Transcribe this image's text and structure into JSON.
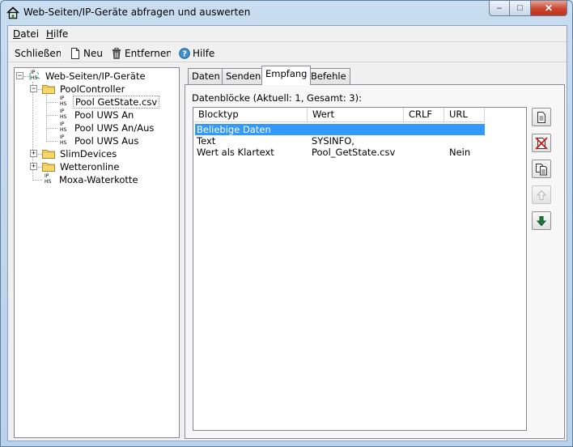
{
  "window": {
    "title": "Web-Seiten/IP-Geräte abfragen und auswerten"
  },
  "titlebar_buttons": {
    "minimize": "–",
    "maximize": "□",
    "close": "✕"
  },
  "menu": {
    "items": [
      {
        "label": "Datei"
      },
      {
        "label": "Hilfe"
      }
    ]
  },
  "toolbar": {
    "close_label": "Schließen",
    "new_label": "Neu",
    "remove_label": "Entfernen",
    "help_label": "Hilfe"
  },
  "tree": {
    "root": "Web-Seiten/IP-Geräte",
    "pool_controller": "PoolController",
    "pool_children": [
      "Pool GetState.csv",
      "Pool UWS An",
      "Pool UWS An/Aus",
      "Pool UWS Aus"
    ],
    "slim_devices": "SlimDevices",
    "wetteronline": "Wetteronline",
    "moxa": "Moxa-Waterkotte",
    "ip_icon_top": "IP",
    "ip_icon_bottom": "HS"
  },
  "tabs": [
    {
      "label": "Daten"
    },
    {
      "label": "Senden"
    },
    {
      "label": "Empfang"
    },
    {
      "label": "Befehle"
    }
  ],
  "panel": {
    "datenbloecke_label": "Datenblöcke (Aktuell: 1, Gesamt: 3):",
    "columns": [
      "Blocktyp",
      "Wert",
      "CRLF",
      "URL"
    ],
    "rows": [
      {
        "blocktyp": "Beliebige Daten",
        "wert": "",
        "crlf": "",
        "url": ""
      },
      {
        "blocktyp": "Text",
        "wert": "SYSINFO,",
        "crlf": "",
        "url": ""
      },
      {
        "blocktyp": "Wert als Klartext",
        "wert": "Pool_GetState.csv",
        "crlf": "",
        "url": "Nein"
      }
    ]
  },
  "side_buttons": [
    {
      "icon": "document-icon",
      "enabled": true
    },
    {
      "icon": "delete-document-icon",
      "enabled": true
    },
    {
      "icon": "copy-document-icon",
      "enabled": true
    },
    {
      "icon": "arrow-up-icon",
      "enabled": false
    },
    {
      "icon": "arrow-down-icon",
      "enabled": true
    }
  ],
  "colors": {
    "selection": "#3399ff",
    "close_button": "#c8452f",
    "arrow_down": "#1a7a3a"
  }
}
